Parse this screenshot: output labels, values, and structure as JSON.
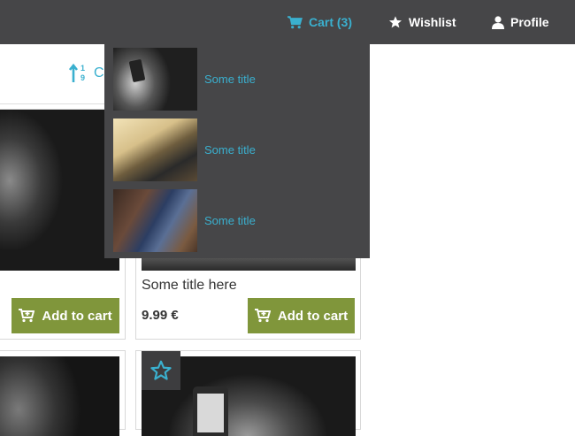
{
  "navbar": {
    "cart_label": "Cart (3)",
    "wishlist_label": "Wishlist",
    "profile_label": "Profile"
  },
  "sort": {
    "label": "C"
  },
  "cart_dropdown": {
    "items": [
      {
        "title": "Some title"
      },
      {
        "title": "Some title"
      },
      {
        "title": "Some title"
      }
    ]
  },
  "products": [
    {
      "add_label": "Add to cart"
    },
    {
      "title": "Some title here",
      "price": "9.99 €",
      "add_label": "Add to cart"
    }
  ],
  "colors": {
    "navbar": "#464648",
    "accent": "#3ab0cf",
    "add_button": "#80963b"
  }
}
